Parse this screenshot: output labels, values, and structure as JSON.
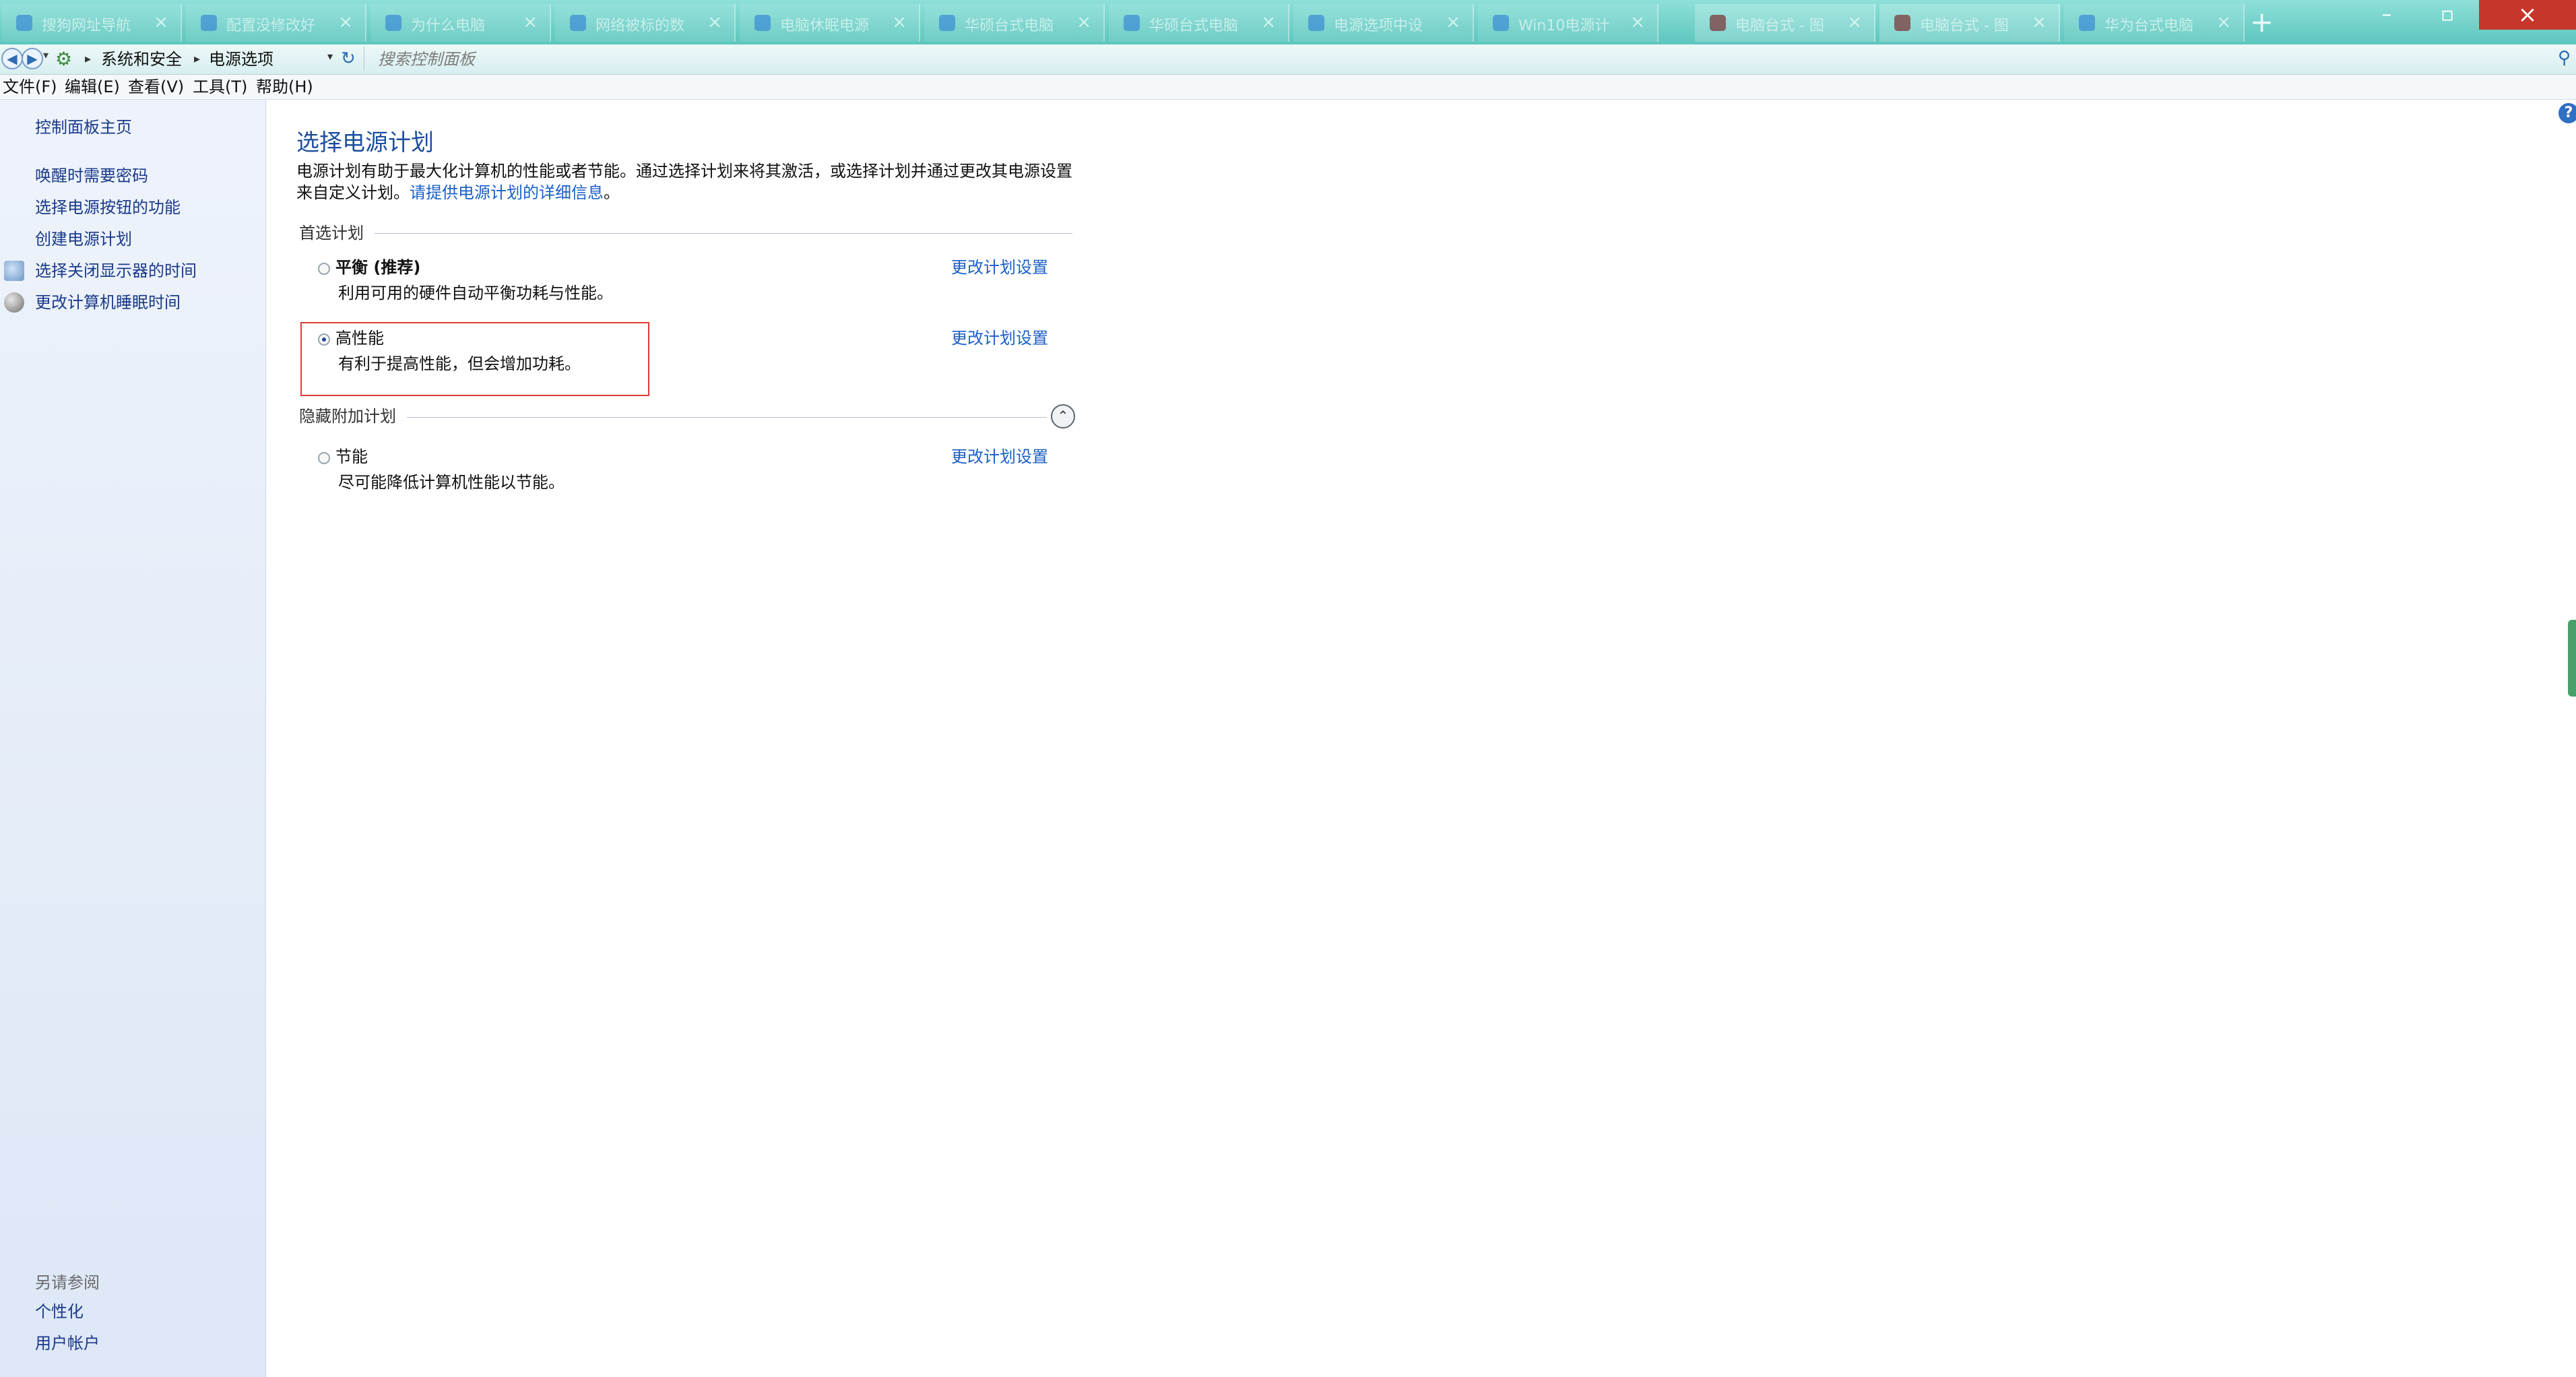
{
  "browser": {
    "tabs": [
      {
        "title": "搜狗网址导航",
        "icon": "sogou-icon",
        "dark": false
      },
      {
        "title": "配置没修改好",
        "icon": "zhihu-icon",
        "dark": false
      },
      {
        "title": "为什么电脑",
        "icon": "zhihu-icon",
        "dark": false
      },
      {
        "title": "网络被标的数",
        "icon": "zhihu-icon",
        "dark": false
      },
      {
        "title": "电脑休眠电源",
        "icon": "zhihu-icon",
        "dark": false
      },
      {
        "title": "华硕台式电脑",
        "icon": "zhihu-icon",
        "dark": false
      },
      {
        "title": "华硕台式电脑",
        "icon": "zhihu-icon",
        "dark": false
      },
      {
        "title": "电源选项中设",
        "icon": "zhihu-icon",
        "dark": false
      },
      {
        "title": "Win10电源计",
        "icon": "zhihu-icon",
        "dark": false
      },
      {
        "title": "电脑台式 - 图",
        "icon": "image-icon",
        "dark": true
      },
      {
        "title": "电脑台式 - 图",
        "icon": "image-icon",
        "dark": true
      },
      {
        "title": "华为台式电脑",
        "icon": "zhihu-icon",
        "dark": false
      }
    ],
    "tab_close_glyph": "×",
    "new_tab_glyph": "+",
    "window_buttons": {
      "minimize": "–",
      "maximize": "▫",
      "close": "×"
    }
  },
  "address": {
    "breadcrumb": [
      "系统和安全",
      "电源选项"
    ],
    "search_placeholder": "搜索控制面板"
  },
  "menu": [
    "文件(F)",
    "编辑(E)",
    "查看(V)",
    "工具(T)",
    "帮助(H)"
  ],
  "left_nav": {
    "home": "控制面板主页",
    "links": [
      "唤醒时需要密码",
      "选择电源按钮的功能",
      "创建电源计划",
      "选择关闭显示器的时间",
      "更改计算机睡眠时间"
    ],
    "see_also_title": "另请参阅",
    "see_also": [
      "个性化",
      "用户帐户"
    ]
  },
  "main": {
    "title": "选择电源计划",
    "description_line1": "电源计划有助于最大化计算机的性能或者节能。通过选择计划来将其激活，或选择计划并通过更改其电源设置",
    "description_line2_pre": "来自定义计划。",
    "description_link": "请提供电源计划的详细信息",
    "description_line2_post": "。",
    "preferred_header": "首选计划",
    "hidden_header": "隐藏附加计划",
    "change_link": "更改计划设置",
    "plans": [
      {
        "name": "平衡 (推荐)",
        "description": "利用可用的硬件自动平衡功耗与性能。",
        "selected": false
      },
      {
        "name": "高性能",
        "description": "有利于提高性能，但会增加功耗。",
        "selected": true
      },
      {
        "name": "节能",
        "description": "尽可能降低计算机性能以节能。",
        "selected": false
      }
    ]
  },
  "colors": {
    "link": "#1b5fc7",
    "title": "#1e4f9c",
    "highlight": "#e03a3a",
    "tabbar": "#5cc6be",
    "close_button": "#c7362a"
  }
}
